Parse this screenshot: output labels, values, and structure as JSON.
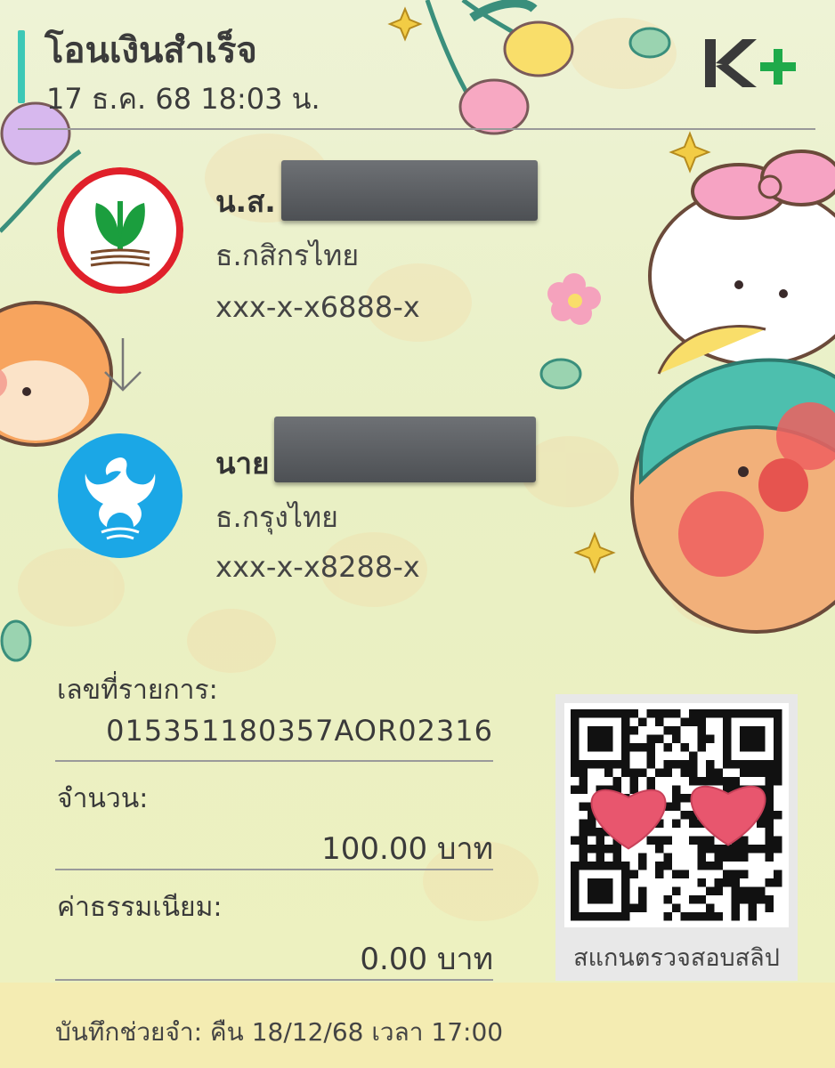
{
  "header": {
    "title": "โอนเงินสำเร็จ",
    "datetime": "17 ธ.ค. 68  18:03 น.",
    "brand_logo": "kplus-logo"
  },
  "sender": {
    "name_prefix": "น.ส.",
    "bank": "ธ.กสิกรไทย",
    "account": "xxx-x-x6888-x",
    "logo": "kasikorn-bank-logo"
  },
  "receiver": {
    "name_prefix": "นาย",
    "bank": "ธ.กรุงไทย",
    "account": "xxx-x-x8288-x",
    "logo": "krungthai-bank-logo"
  },
  "details": {
    "reference_label": "เลขที่รายการ:",
    "reference_value": "015351180357AOR02316",
    "amount_label": "จำนวน:",
    "amount_value": "100.00 บาท",
    "fee_label": "ค่าธรรมเนียม:",
    "fee_value": "0.00 บาท"
  },
  "qr": {
    "caption": "สแกนตรวจสอบสลิป"
  },
  "memo": {
    "text": "บันทึกช่วยจำ:  คืน 18/12/68 เวลา 17:00"
  },
  "colors": {
    "accent": "#3cc8b6",
    "kplus_green": "#1faa4a",
    "kasikorn_green": "#1b9e3e",
    "kasikorn_red": "#e0202a",
    "krungthai_blue": "#1ba7e6",
    "heart": "#e8566e"
  }
}
